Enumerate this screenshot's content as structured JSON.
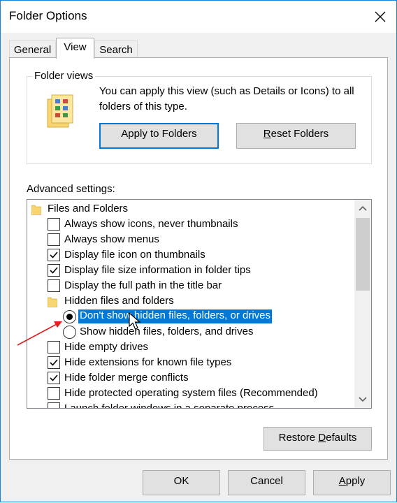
{
  "window": {
    "title": "Folder Options"
  },
  "tabs": [
    {
      "label": "General"
    },
    {
      "label": "View"
    },
    {
      "label": "Search"
    }
  ],
  "folder_views": {
    "legend": "Folder views",
    "description": "You can apply this view (such as Details or Icons) to all folders of this type.",
    "apply_button": "Apply to Folders",
    "reset_button_prefix": "",
    "reset_button_accel": "R",
    "reset_button_rest": "eset Folders"
  },
  "advanced": {
    "label": "Advanced settings:",
    "category": "Files and Folders",
    "items": [
      {
        "label": "Always show icons, never thumbnails",
        "checked": false
      },
      {
        "label": "Always show menus",
        "checked": false
      },
      {
        "label": "Display file icon on thumbnails",
        "checked": true
      },
      {
        "label": "Display file size information in folder tips",
        "checked": true
      },
      {
        "label": "Display the full path in the title bar",
        "checked": false
      }
    ],
    "hidden_group": "Hidden files and folders",
    "radios": [
      {
        "label": "Don't show hidden files, folders, or drives",
        "selected": true
      },
      {
        "label": "Show hidden files, folders, and drives",
        "selected": false
      }
    ],
    "items2": [
      {
        "label": "Hide empty drives",
        "checked": false
      },
      {
        "label": "Hide extensions for known file types",
        "checked": true
      },
      {
        "label": "Hide folder merge conflicts",
        "checked": true
      },
      {
        "label": "Hide protected operating system files (Recommended)",
        "checked": false
      },
      {
        "label": "Launch folder windows in a separate process",
        "checked": false
      }
    ]
  },
  "restore": {
    "prefix": "Restore ",
    "accel": "D",
    "rest": "efaults"
  },
  "footer": {
    "ok": "OK",
    "cancel": "Cancel",
    "apply_accel": "A",
    "apply_rest": "pply"
  },
  "colors": {
    "accent": "#0078d7",
    "annotation_arrow": "#e02020",
    "folder": "#f6d572"
  }
}
